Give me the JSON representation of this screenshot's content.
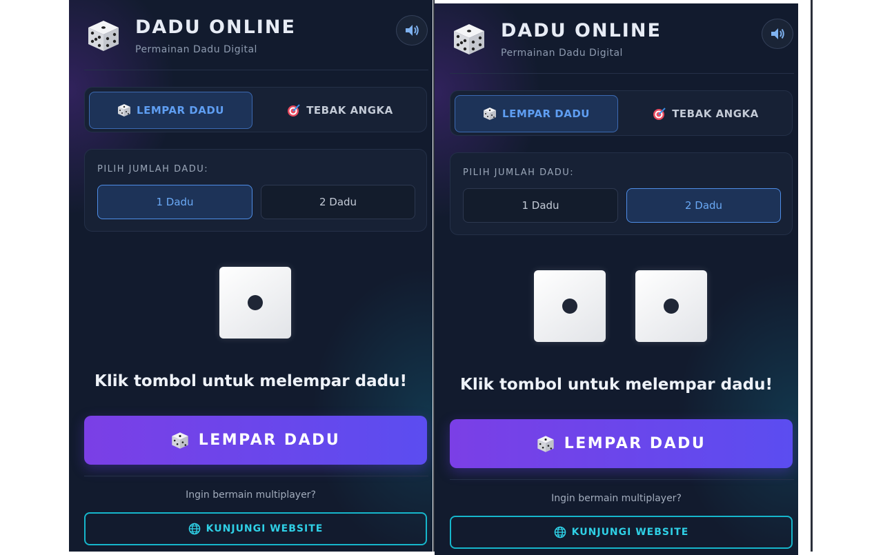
{
  "app": {
    "title": "DADU ONLINE",
    "subtitle": "Permainan Dadu Digital"
  },
  "icons": {
    "logo": "dice-icon",
    "sound": "speaker-icon",
    "roll_tab": "dice-icon",
    "guess_tab": "target-icon",
    "website": "globe-icon"
  },
  "colors": {
    "accent_blue": "#5f9ef2",
    "roll_gradient_start": "#7b3fe6",
    "roll_gradient_end": "#5b4df0",
    "website_cyan": "#2fd0e6",
    "background": "#121b2e"
  },
  "tabs": [
    {
      "label": "LEMPAR DADU",
      "active": true
    },
    {
      "label": "TEBAK ANGKA",
      "active": false
    }
  ],
  "dice_count": {
    "label": "PILIH JUMLAH DADU:",
    "options": [
      "1 Dadu",
      "2 Dadu"
    ]
  },
  "hint": "Klik tombol untuk melempar dadu!",
  "roll_button": "LEMPAR DADU",
  "multiplayer_text": "Ingin bermain multiplayer?",
  "website_button": "KUNJUNGI WEBSITE",
  "screens": [
    {
      "selected_count": "1 Dadu",
      "dice_values": [
        1
      ]
    },
    {
      "selected_count": "2 Dadu",
      "dice_values": [
        1,
        1
      ]
    }
  ]
}
